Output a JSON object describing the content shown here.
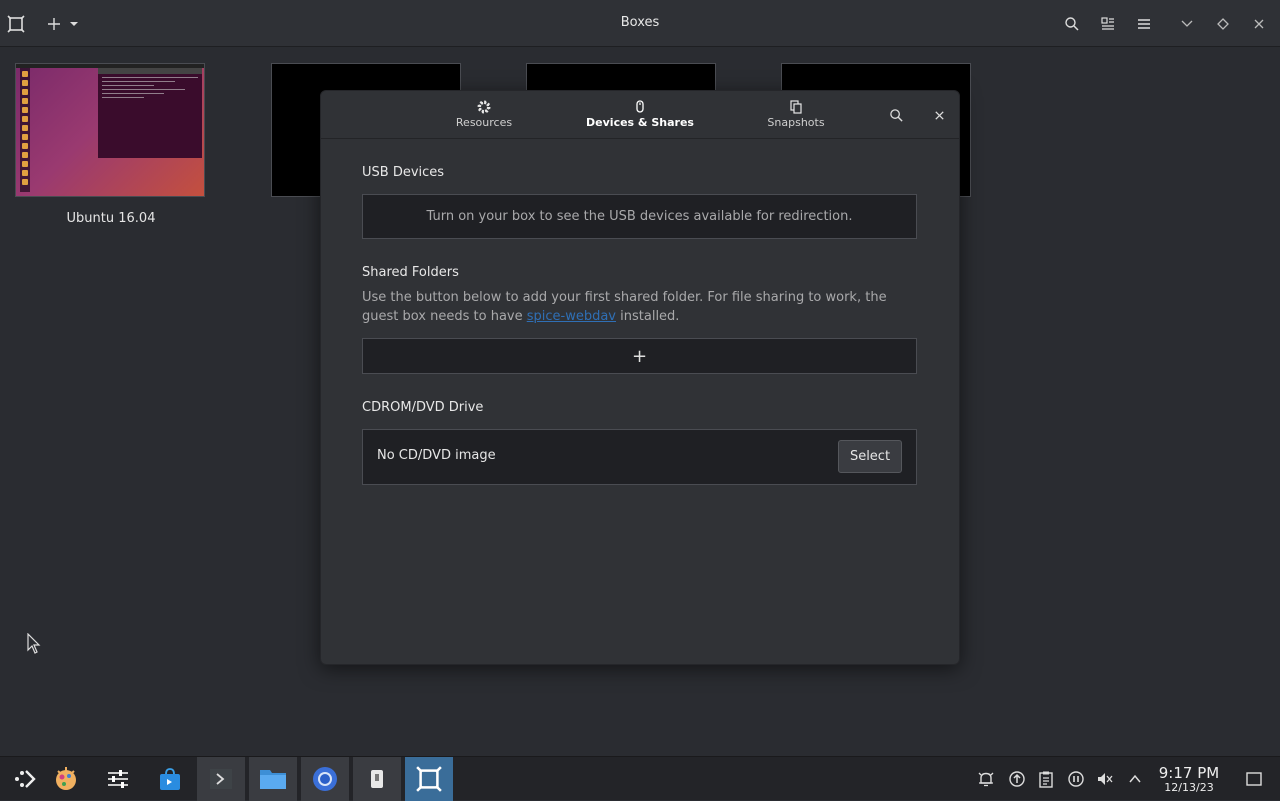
{
  "header": {
    "title": "Boxes"
  },
  "boxes": [
    {
      "name": "Ubuntu 16.04"
    },
    {
      "name": ""
    },
    {
      "name": ""
    },
    {
      "name": ""
    }
  ],
  "dialog": {
    "tabs": [
      {
        "label": "Resources",
        "icon": "gear-icon"
      },
      {
        "label": "Devices & Shares",
        "icon": "mouse-icon"
      },
      {
        "label": "Snapshots",
        "icon": "copy-icon"
      }
    ],
    "usb": {
      "title": "USB Devices",
      "message": "Turn on your box to see the USB devices available for redirection."
    },
    "shared": {
      "title": "Shared Folders",
      "desc_before": "Use the button below to add your first shared folder. For file sharing to work, the guest box needs to have ",
      "link": "spice-webdav",
      "desc_after": " installed.",
      "add_label": "+"
    },
    "cdrom": {
      "title": "CDROM/DVD Drive",
      "status": "No CD/DVD image",
      "select_label": "Select"
    }
  },
  "taskbar": {
    "time": "9:17 PM",
    "date": "12/13/23"
  },
  "colors": {
    "accent": "#3a6d99",
    "link": "#2f6fb5",
    "background": "#2a2c31",
    "dialog": "#303236"
  }
}
